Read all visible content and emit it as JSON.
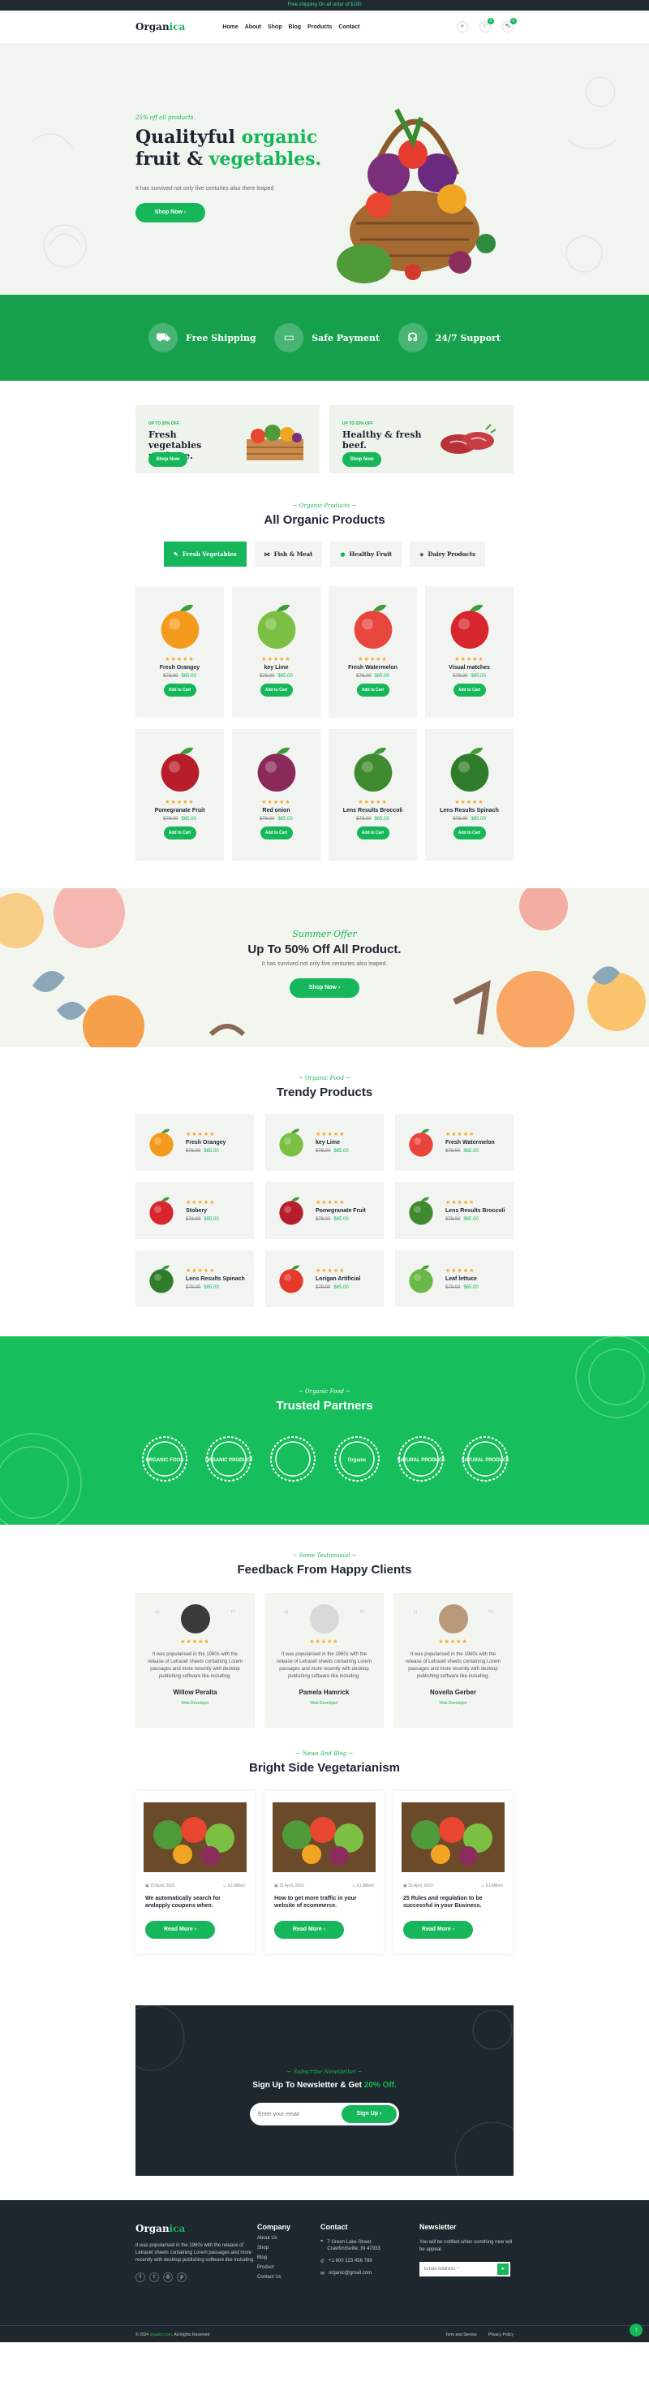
{
  "topbar": {
    "text": "Free shipping On all order of $100"
  },
  "header": {
    "logo_a": "Organ",
    "logo_b": "ica",
    "nav": [
      "Home",
      "About",
      "Shop",
      "Blog",
      "Products",
      "Contact"
    ],
    "wishlist_count": "0",
    "cart_count": "0"
  },
  "hero": {
    "subtitle": "25% off all products.",
    "title_a": "Qualityful ",
    "title_b": "organic",
    "title_c": "fruit & ",
    "title_d": "vegetables.",
    "desc": "It has survived not only five centuries also there leaped",
    "button": "Shop Now"
  },
  "features": [
    {
      "label": "Free Shipping",
      "icon": "truck-icon"
    },
    {
      "label": "Safe Payment",
      "icon": "card-icon"
    },
    {
      "label": "24/7 Support",
      "icon": "headset-icon"
    }
  ],
  "promos": [
    {
      "tag": "UP TO 20% OFF",
      "title": "Fresh vegetables package.",
      "button": "Shop Now"
    },
    {
      "tag": "UP TO 25% OFF",
      "title": "Healthy & fresh beef.",
      "button": "Shop Now"
    }
  ],
  "organic": {
    "subtitle": "Organic Products",
    "title": "All Organic Products",
    "tabs": [
      "Fresh Vegetables",
      "Fish & Meat",
      "Healthy Fruit",
      "Dairy Products"
    ],
    "products": [
      {
        "name": "Fresh Orangey",
        "old": "$78.00",
        "price": "$65.00",
        "button": "Add to Cart",
        "color": "#f49a1c"
      },
      {
        "name": "key Lime",
        "old": "$78.00",
        "price": "$65.00",
        "button": "Add to Cart",
        "color": "#7bc043"
      },
      {
        "name": "Fresh Watermelon",
        "old": "$78.00",
        "price": "$65.00",
        "button": "Add to Cart",
        "color": "#e8453c"
      },
      {
        "name": "Visual matches",
        "old": "$78.00",
        "price": "$65.00",
        "button": "Add to Cart",
        "color": "#d8262e"
      },
      {
        "name": "Pomegranate Fruit",
        "old": "$78.00",
        "price": "$65.00",
        "button": "Add to Cart",
        "color": "#b81d2b"
      },
      {
        "name": "Red onion",
        "old": "$78.00",
        "price": "$65.00",
        "button": "Add to Cart",
        "color": "#8a2a5a"
      },
      {
        "name": "Lens Results Broccoli",
        "old": "$78.00",
        "price": "$65.00",
        "button": "Add to Cart",
        "color": "#3f8a2e"
      },
      {
        "name": "Lens Results Spinach",
        "old": "$78.00",
        "price": "$65.00",
        "button": "Add to Cart",
        "color": "#2f7d2a"
      }
    ]
  },
  "summer": {
    "subtitle": "Summer Offer",
    "title": "Up To 50% Off All Product.",
    "desc": "It has survived not only five centuries also leaped.",
    "button": "Shop Now"
  },
  "trendy": {
    "subtitle": "Organic Food",
    "title": "Trendy Products",
    "items": [
      {
        "name": "Fresh Orangey",
        "old": "$78.00",
        "price": "$65.00",
        "color": "#f49a1c"
      },
      {
        "name": "key Lime",
        "old": "$78.00",
        "price": "$65.00",
        "color": "#7bc043"
      },
      {
        "name": "Fresh Watermelon",
        "old": "$78.00",
        "price": "$65.00",
        "color": "#e8453c"
      },
      {
        "name": "Stobery",
        "old": "$78.00",
        "price": "$65.00",
        "color": "#d8262e"
      },
      {
        "name": "Pomegranate Fruit",
        "old": "$78.00",
        "price": "$65.00",
        "color": "#b81d2b"
      },
      {
        "name": "Lens Results Broccoli",
        "old": "$78.00",
        "price": "$65.00",
        "color": "#3f8a2e"
      },
      {
        "name": "Lens Results Spinach",
        "old": "$78.00",
        "price": "$65.00",
        "color": "#2f7d2a"
      },
      {
        "name": "Lorigan Artificial",
        "old": "$78.00",
        "price": "$65.00",
        "color": "#e53a2a"
      },
      {
        "name": "Leaf lettuce",
        "old": "$78.00",
        "price": "$65.00",
        "color": "#6ab845"
      }
    ]
  },
  "partners": {
    "subtitle": "Organic Food",
    "title": "Trusted Partners",
    "badges": [
      "ORGANIC FOOD",
      "ORGANIC PRODUCT",
      "",
      "Organic",
      "NATURAL PRODUCT",
      "NATURAL PRODUCT"
    ]
  },
  "testimonials": {
    "subtitle": "Some Testimonial",
    "title": "Feedback From Happy Clients",
    "items": [
      {
        "text": "It was popularised in the 1960s with the release of Letraset sheets containing Lorem passages and more recently with desktop publishing software like including.",
        "name": "Willow Peralta",
        "role": "Web Developer"
      },
      {
        "text": "It was popularised in the 1960s with the release of Letraset sheets containing Lorem passages and more recently with desktop publishing software like including.",
        "name": "Pamela Hamrick",
        "role": "Web Developer"
      },
      {
        "text": "It was popularised in the 1960s with the release of Letraset sheets containing Lorem passages and more recently with desktop publishing software like including.",
        "name": "Novella Gerber",
        "role": "Web Developer"
      }
    ]
  },
  "blog": {
    "subtitle": "News And Blog",
    "title": "Bright Side Vegetarianism",
    "posts": [
      {
        "date": "15 April, 2023",
        "author": "ILLMillion",
        "title": "We automatically search for andapply coupons when.",
        "button": "Read More"
      },
      {
        "date": "15 April, 2023",
        "author": "ILLMillion",
        "title": "How to get more traffic in your website of ecommerce.",
        "button": "Read More"
      },
      {
        "date": "15 April, 2023",
        "author": "ILLMillion",
        "title": "25 Rules and regulation to be successful in your Business.",
        "button": "Read More"
      }
    ]
  },
  "newsletter": {
    "subtitle": "Subscribe Newsletter",
    "title_a": "Sign Up To Newsletter & Get ",
    "title_b": "20% Off.",
    "placeholder": "Enter your email",
    "button": "Sign Up"
  },
  "footer": {
    "about": "It was popularised in the 1960s with the release of Letraset sheets containing Lorem passages and more recently with desktop publishing software like including.",
    "company_title": "Company",
    "company_links": [
      "About Us",
      "Shop",
      "Blog",
      "Product",
      "Contact Us"
    ],
    "contact_title": "Contact",
    "address": "7 Green Lake Street Crawfordsville, IN 47933",
    "phone": "+1 800 123 456 789",
    "email": "organic@gmail.com",
    "newsletter_title": "Newsletter",
    "newsletter_text": "You will be notified when somthing new will be appear.",
    "newsletter_placeholder": "Email Address *",
    "copyright_a": "© 2024 ",
    "copyright_b": "organic.com",
    "copyright_c": ". All Rights Reserved",
    "links": [
      "Term and Service",
      "Privacy Policy"
    ]
  }
}
